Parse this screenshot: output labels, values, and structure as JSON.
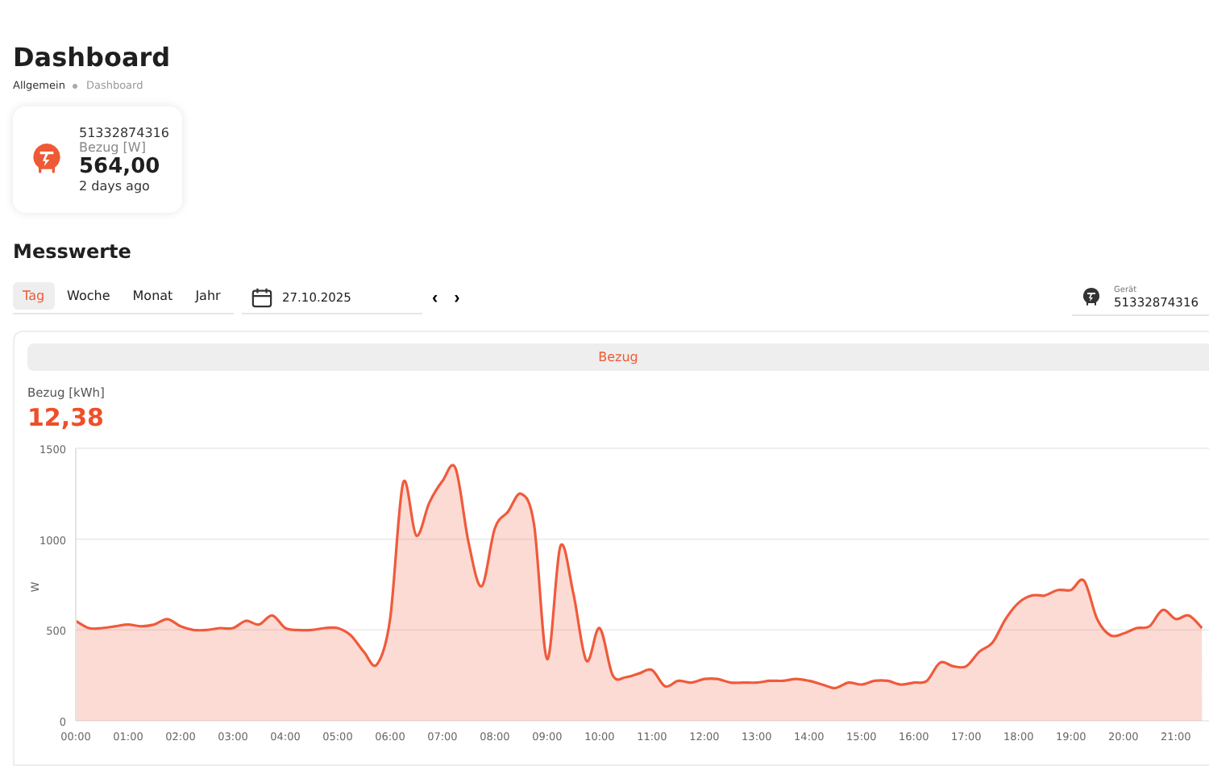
{
  "page": {
    "title": "Dashboard",
    "breadcrumb": [
      {
        "label": "Allgemein",
        "current": false
      },
      {
        "label": "Dashboard",
        "current": true
      }
    ]
  },
  "meter_card": {
    "serial": "51332874316",
    "label": "Bezug [W]",
    "value": "564,00",
    "time": "2 days ago"
  },
  "section": {
    "title": "Messwerte"
  },
  "period_tabs": [
    {
      "label": "Tag",
      "selected": true
    },
    {
      "label": "Woche",
      "selected": false
    },
    {
      "label": "Monat",
      "selected": false
    },
    {
      "label": "Jahr",
      "selected": false
    }
  ],
  "date_field": {
    "value": "27.10.2025"
  },
  "nav": {
    "prev": "‹",
    "next": "›"
  },
  "device_field": {
    "label": "Gerät",
    "value": "51332874316"
  },
  "panel": {
    "tab": "Bezug",
    "total_label": "Bezug [kWh]",
    "total_value": "12,38",
    "chart_data": {
      "type": "area",
      "ylabel": "W",
      "x": [
        0,
        0.25,
        0.5,
        0.75,
        1,
        1.25,
        1.5,
        1.75,
        2,
        2.25,
        2.5,
        2.75,
        3,
        3.25,
        3.5,
        3.75,
        4,
        4.25,
        4.5,
        4.75,
        5,
        5.25,
        5.5,
        5.75,
        6,
        6.25,
        6.5,
        6.75,
        7,
        7.25,
        7.5,
        7.75,
        8,
        8.25,
        8.5,
        8.75,
        9,
        9.25,
        9.5,
        9.75,
        10,
        10.25,
        10.5,
        10.75,
        11,
        11.25,
        11.5,
        11.75,
        12,
        12.25,
        12.5,
        12.75,
        13,
        13.25,
        13.5,
        13.75,
        14,
        14.25,
        14.5,
        14.75,
        15,
        15.25,
        15.5,
        15.75,
        16,
        16.25,
        16.5,
        16.75,
        17,
        17.25,
        17.5,
        17.75,
        18,
        18.25,
        18.5,
        18.75,
        19,
        19.25,
        19.5,
        19.75,
        20,
        20.25,
        20.5,
        20.75,
        21,
        21.25,
        21.5
      ],
      "series": [
        {
          "color": "#f05a3c",
          "values": [
            550,
            510,
            510,
            520,
            530,
            520,
            530,
            560,
            520,
            500,
            500,
            510,
            510,
            550,
            530,
            580,
            510,
            500,
            500,
            510,
            510,
            470,
            380,
            310,
            560,
            1310,
            1020,
            1200,
            1320,
            1390,
            980,
            740,
            1060,
            1150,
            1250,
            1080,
            340,
            960,
            700,
            330,
            510,
            250,
            240,
            260,
            280,
            190,
            220,
            210,
            230,
            230,
            210,
            210,
            210,
            220,
            220,
            230,
            220,
            200,
            180,
            210,
            200,
            220,
            220,
            200,
            210,
            220,
            320,
            300,
            300,
            380,
            430,
            560,
            650,
            690,
            690,
            720,
            720,
            770,
            560,
            470,
            480,
            510,
            520,
            610,
            560,
            580,
            510
          ]
        }
      ],
      "xlim": [
        0,
        21.85
      ],
      "ylim": [
        0,
        1500
      ],
      "yticks": [
        0,
        500,
        1000,
        1500
      ],
      "xticks": [
        {
          "value": 0,
          "label": "00:00"
        },
        {
          "value": 1,
          "label": "01:00"
        },
        {
          "value": 2,
          "label": "02:00"
        },
        {
          "value": 3,
          "label": "03:00"
        },
        {
          "value": 4,
          "label": "04:00"
        },
        {
          "value": 5,
          "label": "05:00"
        },
        {
          "value": 6,
          "label": "06:00"
        },
        {
          "value": 7,
          "label": "07:00"
        },
        {
          "value": 8,
          "label": "08:00"
        },
        {
          "value": 9,
          "label": "09:00"
        },
        {
          "value": 10,
          "label": "10:00"
        },
        {
          "value": 11,
          "label": "11:00"
        },
        {
          "value": 12,
          "label": "12:00"
        },
        {
          "value": 13,
          "label": "13:00"
        },
        {
          "value": 14,
          "label": "14:00"
        },
        {
          "value": 15,
          "label": "15:00"
        },
        {
          "value": 16,
          "label": "16:00"
        },
        {
          "value": 17,
          "label": "17:00"
        },
        {
          "value": 18,
          "label": "18:00"
        },
        {
          "value": 19,
          "label": "19:00"
        },
        {
          "value": 20,
          "label": "20:00"
        },
        {
          "value": 21,
          "label": "21:00"
        }
      ]
    }
  }
}
